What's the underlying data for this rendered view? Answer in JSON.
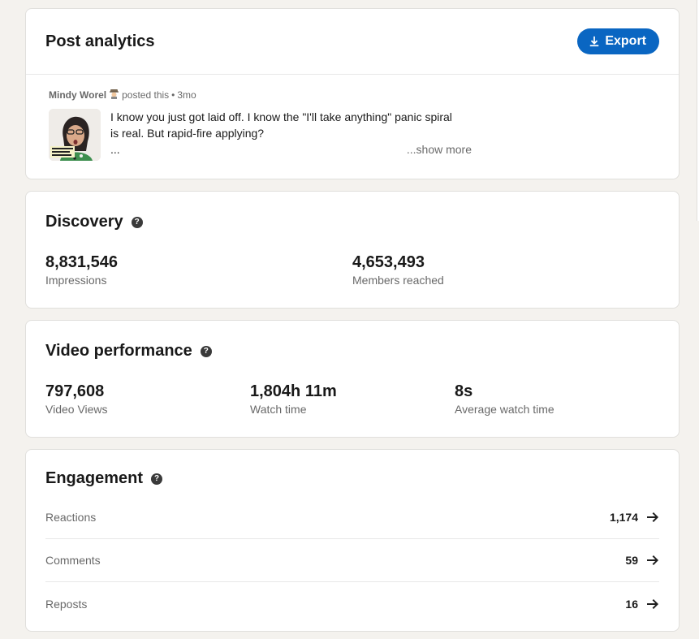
{
  "header": {
    "title": "Post analytics",
    "export_label": "Export"
  },
  "post": {
    "author": "Mindy Worel",
    "author_badge_icon": "detective-emoji",
    "posted_text": "posted this",
    "separator": "•",
    "age": "3mo",
    "line1": "I know you just got laid off. I know the \"I'll take anything\" panic spiral",
    "line2": "is real. But rapid-fire applying?",
    "line3": "...",
    "show_more": "...show more",
    "thumbnail_icon": "video-thumbnail"
  },
  "discovery": {
    "title": "Discovery",
    "help_glyph": "?",
    "metrics": [
      {
        "value": "8,831,546",
        "label": "Impressions"
      },
      {
        "value": "4,653,493",
        "label": "Members reached"
      }
    ]
  },
  "video": {
    "title": "Video performance",
    "help_glyph": "?",
    "metrics": [
      {
        "value": "797,608",
        "label": "Video Views"
      },
      {
        "value": "1,804h 11m",
        "label": "Watch time"
      },
      {
        "value": "8s",
        "label": "Average watch time"
      }
    ]
  },
  "engagement": {
    "title": "Engagement",
    "help_glyph": "?",
    "rows": [
      {
        "label": "Reactions",
        "count": "1,174"
      },
      {
        "label": "Comments",
        "count": "59"
      },
      {
        "label": "Reposts",
        "count": "16"
      }
    ]
  },
  "colors": {
    "background": "#f4f2ee",
    "card": "#ffffff",
    "accent": "#0a66c2"
  }
}
